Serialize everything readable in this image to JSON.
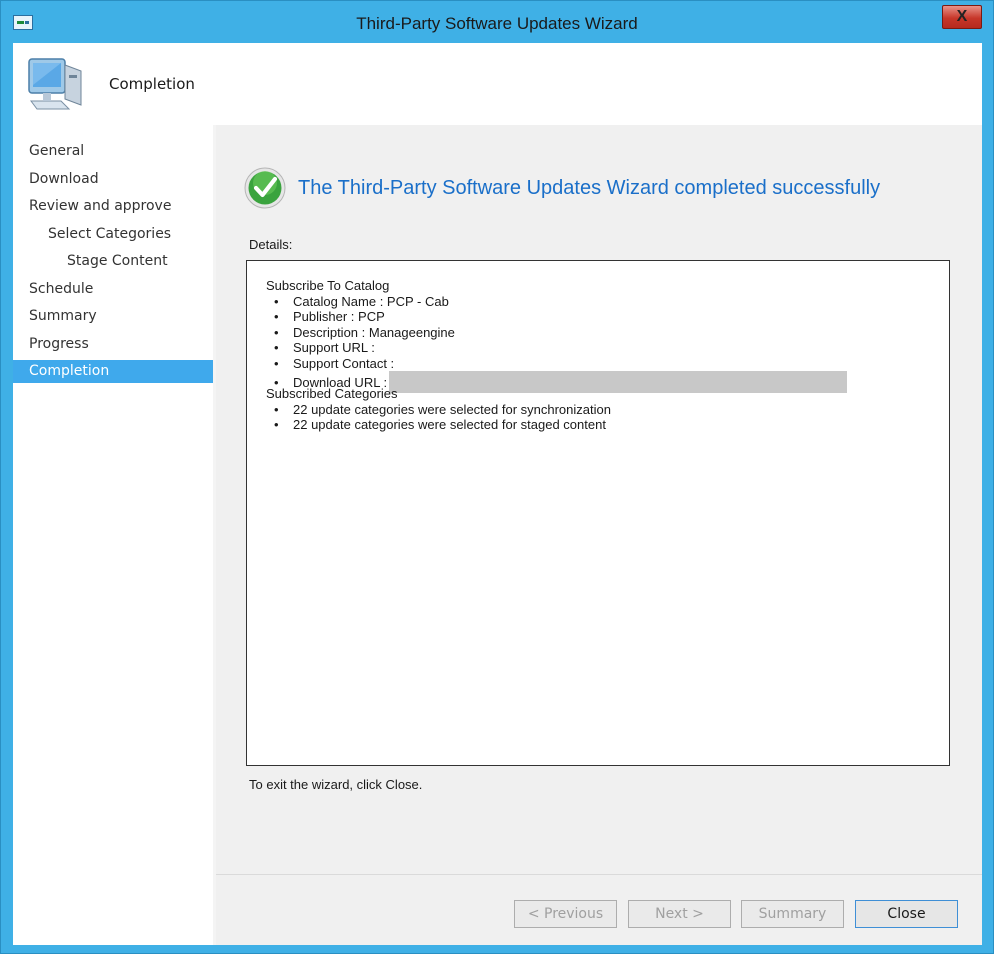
{
  "window": {
    "title": "Third-Party Software Updates Wizard",
    "close_glyph": "X"
  },
  "header": {
    "title": "Completion",
    "icon": "computer-icon"
  },
  "sidebar": {
    "items": [
      {
        "label": "General"
      },
      {
        "label": "Download"
      },
      {
        "label": "Review and approve"
      },
      {
        "label": "Select Categories"
      },
      {
        "label": "Stage Content"
      },
      {
        "label": "Schedule"
      },
      {
        "label": "Summary"
      },
      {
        "label": "Progress"
      },
      {
        "label": "Completion"
      }
    ]
  },
  "main": {
    "success_message": "The Third-Party Software Updates Wizard completed successfully",
    "details_label": "Details:",
    "details": {
      "section1_title": "Subscribe To Catalog",
      "catalog_name": "Catalog Name : PCP - Cab",
      "publisher": "Publisher : PCP",
      "description": "Description : Manageengine",
      "support_url": "Support URL :",
      "support_contact": "Support Contact :",
      "download_url": "Download URL :",
      "section2_title": "Subscribed Categories",
      "sync_line": "22 update categories were selected for synchronization",
      "staged_line": "22 update categories were selected for staged content"
    },
    "exit_text": "To exit the wizard, click Close."
  },
  "buttons": {
    "previous": "< Previous",
    "next": "Next >",
    "summary": "Summary",
    "close": "Close"
  },
  "colors": {
    "accent": "#3fb0e6",
    "active_nav": "#3fa9ec",
    "success_text": "#1a6fc9"
  }
}
